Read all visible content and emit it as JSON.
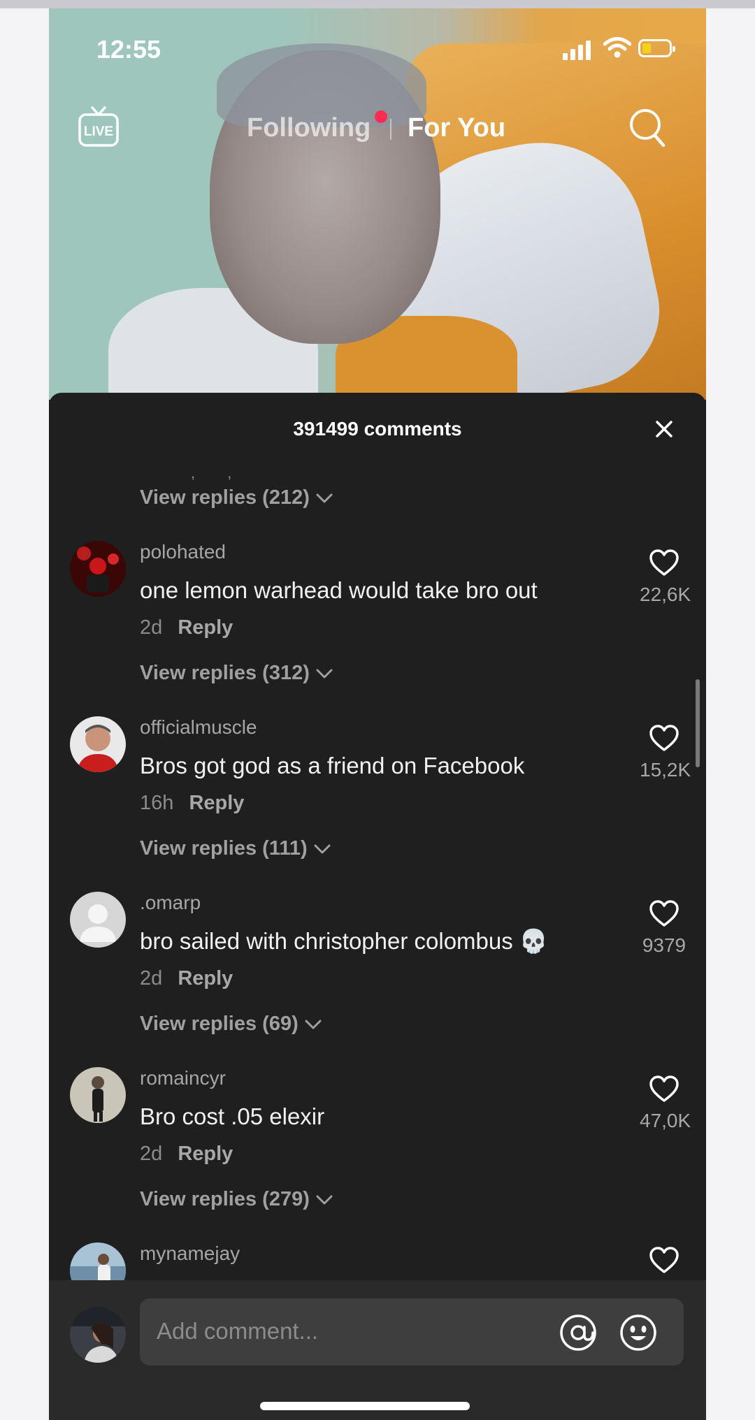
{
  "status_bar": {
    "time": "12:55",
    "battery_color": "#f2d21b"
  },
  "top_nav": {
    "live_label": "LIVE",
    "following": "Following",
    "for_you": "For You",
    "dot_color": "#fe2c55"
  },
  "comments": {
    "title": "391499 comments",
    "first_view_replies": "View replies (212)",
    "items": [
      {
        "username": "polohated",
        "text": "one lemon warhead would take bro out",
        "time": "2d",
        "reply": "Reply",
        "likes": "22,6K",
        "view_replies": "View replies (312)"
      },
      {
        "username": "officialmuscle",
        "text": "Bros got god as a friend on Facebook",
        "time": "16h",
        "reply": "Reply",
        "likes": "15,2K",
        "view_replies": "View replies (111)"
      },
      {
        "username": ".omarp",
        "text": "bro sailed with christopher colombus 💀",
        "time": "2d",
        "reply": "Reply",
        "likes": "9379",
        "view_replies": "View replies (69)"
      },
      {
        "username": "romaincyr",
        "text": "Bro cost .05 elexir",
        "time": "2d",
        "reply": "Reply",
        "likes": "47,0K",
        "view_replies": "View replies (279)"
      },
      {
        "username": "mynamejay"
      }
    ]
  },
  "composer": {
    "placeholder": "Add comment..."
  }
}
